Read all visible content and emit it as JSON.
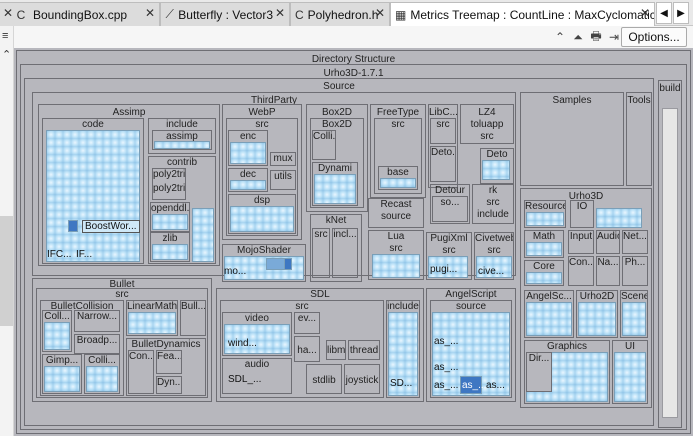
{
  "tabs": [
    {
      "label": "BoundingBox.cpp",
      "icon": "cpp-file-icon"
    },
    {
      "label": "Butterfly : Vector3",
      "icon": "graph-icon"
    },
    {
      "label": "Polyhedron.h",
      "icon": "cpp-file-icon"
    },
    {
      "label": "Metrics Treemap : CountLine : MaxCyclomatic",
      "icon": "treemap-icon",
      "active": true
    }
  ],
  "toolbar": {
    "options_label": "Options..."
  },
  "treemap": {
    "root": "Directory Structure",
    "project": "Urho3D-1.7.1",
    "source": "Source",
    "thirdparty": "ThirdParty",
    "groups": {
      "assimp": {
        "title": "Assimp",
        "code": "code",
        "include": "include",
        "include_child": "assimp",
        "contrib": "contrib",
        "poly2tri_a": "poly2tri",
        "poly2tri_b": "poly2tri",
        "openddl": "openddl..",
        "zlib": "zlib",
        "boost": "BoostWor...",
        "ifc1": "IFC...",
        "ifc2": "IF..."
      },
      "webp": {
        "title": "WebP",
        "src": "src",
        "enc": "enc",
        "mux": "mux",
        "dec": "dec",
        "utils": "utils",
        "dsp": "dsp"
      },
      "box2d": {
        "title": "Box2D",
        "inner": "Box2D",
        "colli": "Colli...",
        "dynami": "Dynami"
      },
      "freetype": {
        "title": "FreeType",
        "src": "src",
        "base": "base"
      },
      "libc": {
        "title": "LibC...",
        "src": "src",
        "deto": "Deto..."
      },
      "lz4": {
        "title": "LZ4",
        "toluapp": "toluapp",
        "src": "src",
        "deto": "Deto"
      },
      "knet": {
        "title": "kNet",
        "src": "src",
        "incl": "incl..."
      },
      "detour": {
        "title": "Detour",
        "so": "so..."
      },
      "rk": {
        "title": "rk",
        "src": "src",
        "include": "include"
      },
      "recast": {
        "title": "Recast",
        "source": "source"
      },
      "mojoshader": {
        "title": "MojoShader",
        "mo": "mo..."
      },
      "lua": {
        "title": "Lua",
        "src": "src"
      },
      "pugixml": {
        "title": "PugiXml",
        "src": "src",
        "pugi": "pugi..."
      },
      "civetweb": {
        "title": "Civetweb",
        "src": "src",
        "cive": "cive..."
      }
    },
    "samples": "Samples",
    "tools": "Tools",
    "build": "build",
    "urho3d": {
      "title": "Urho3D",
      "resource": "Resource",
      "io": "IO",
      "math": "Math",
      "input": "Input",
      "audio": "Audio",
      "net": "Net...",
      "core": "Core",
      "con": "Con...",
      "na": "Na...",
      "ph": "Ph...",
      "angelsc": "AngelSc...",
      "urho2d": "Urho2D",
      "scene": "Scene",
      "graphics": "Graphics",
      "ui": "UI",
      "dir": "Dir..."
    },
    "bullet": {
      "title": "Bullet",
      "src": "src",
      "collision": "BulletCollision",
      "linearmath": "LinearMath",
      "bull": "Bull...",
      "coll": "Coll...",
      "narrow": "Narrow...",
      "broadp": "Broadp...",
      "gimp": "Gimp...",
      "colli2": "Colli...",
      "dynamics": "BulletDynamics",
      "con": "Con...",
      "fea": "Fea...",
      "dyn": "Dyn..."
    },
    "sdl": {
      "title": "SDL",
      "src": "src",
      "video": "video",
      "ev": "ev...",
      "ha": "ha...",
      "wind": "wind...",
      "audio": "audio",
      "sdl": "SDL_...",
      "stdlib": "stdlib",
      "libm": "libm",
      "thread": "thread",
      "joystick": "joystick",
      "include": "include",
      "sd": "SD..."
    },
    "angelscript": {
      "title": "AngelScript",
      "source": "source",
      "as1": "as_...",
      "as2": "as_...",
      "as3": "as_...",
      "as4": "as_...",
      "as5": "as..."
    }
  },
  "colors": {
    "frame": "#b7b7bd",
    "leaf": "#a8d4ee",
    "highlight_dark": "#3e77c2",
    "highlight_mid": "#7aaad8"
  }
}
